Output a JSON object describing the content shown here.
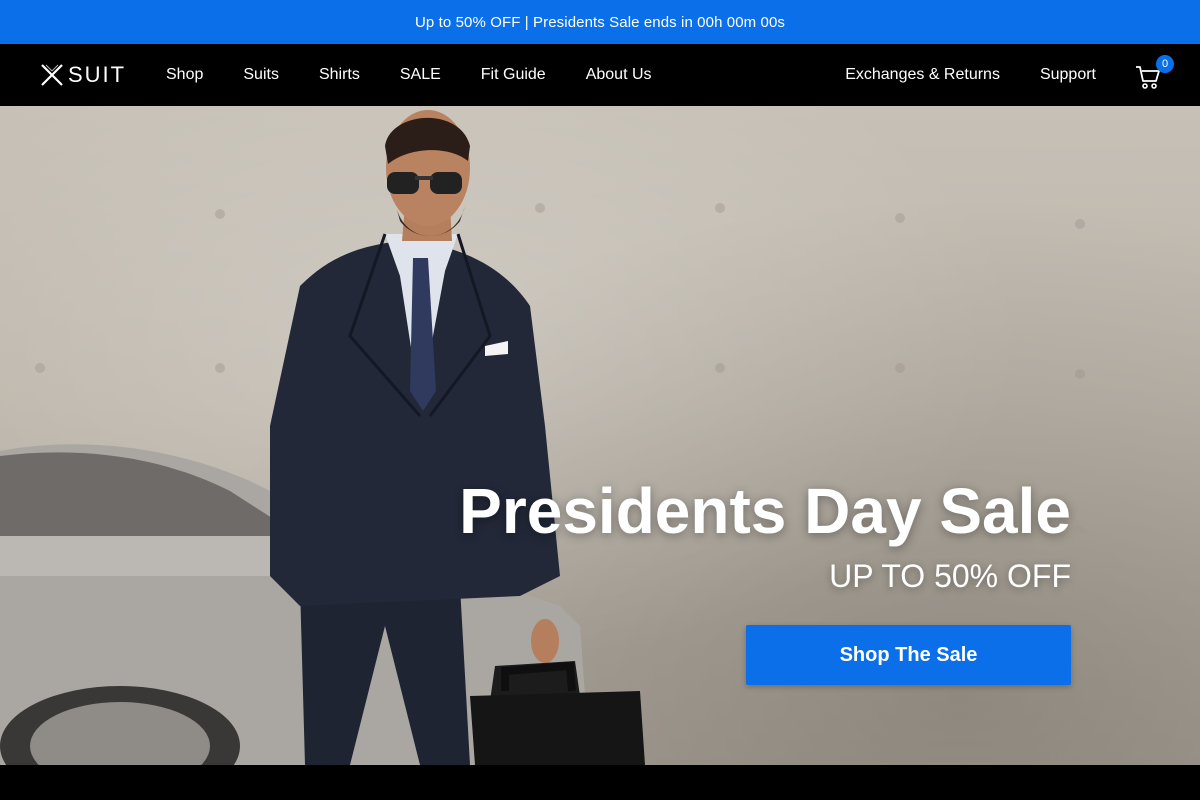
{
  "announcement": {
    "text": "Up to 50% OFF | Presidents Sale ends in 00h 00m 00s"
  },
  "header": {
    "logo_text": "SUIT",
    "nav_left": [
      "Shop",
      "Suits",
      "Shirts",
      "SALE",
      "Fit Guide",
      "About Us"
    ],
    "nav_right": [
      "Exchanges & Returns",
      "Support"
    ],
    "cart_count": "0",
    "cart_icon": "cart-icon"
  },
  "hero": {
    "title": "Presidents Day Sale",
    "subtitle": "UP TO 50% OFF",
    "cta_label": "Shop The Sale"
  },
  "colors": {
    "accent": "#0a6fe8",
    "header_bg": "#000000"
  }
}
